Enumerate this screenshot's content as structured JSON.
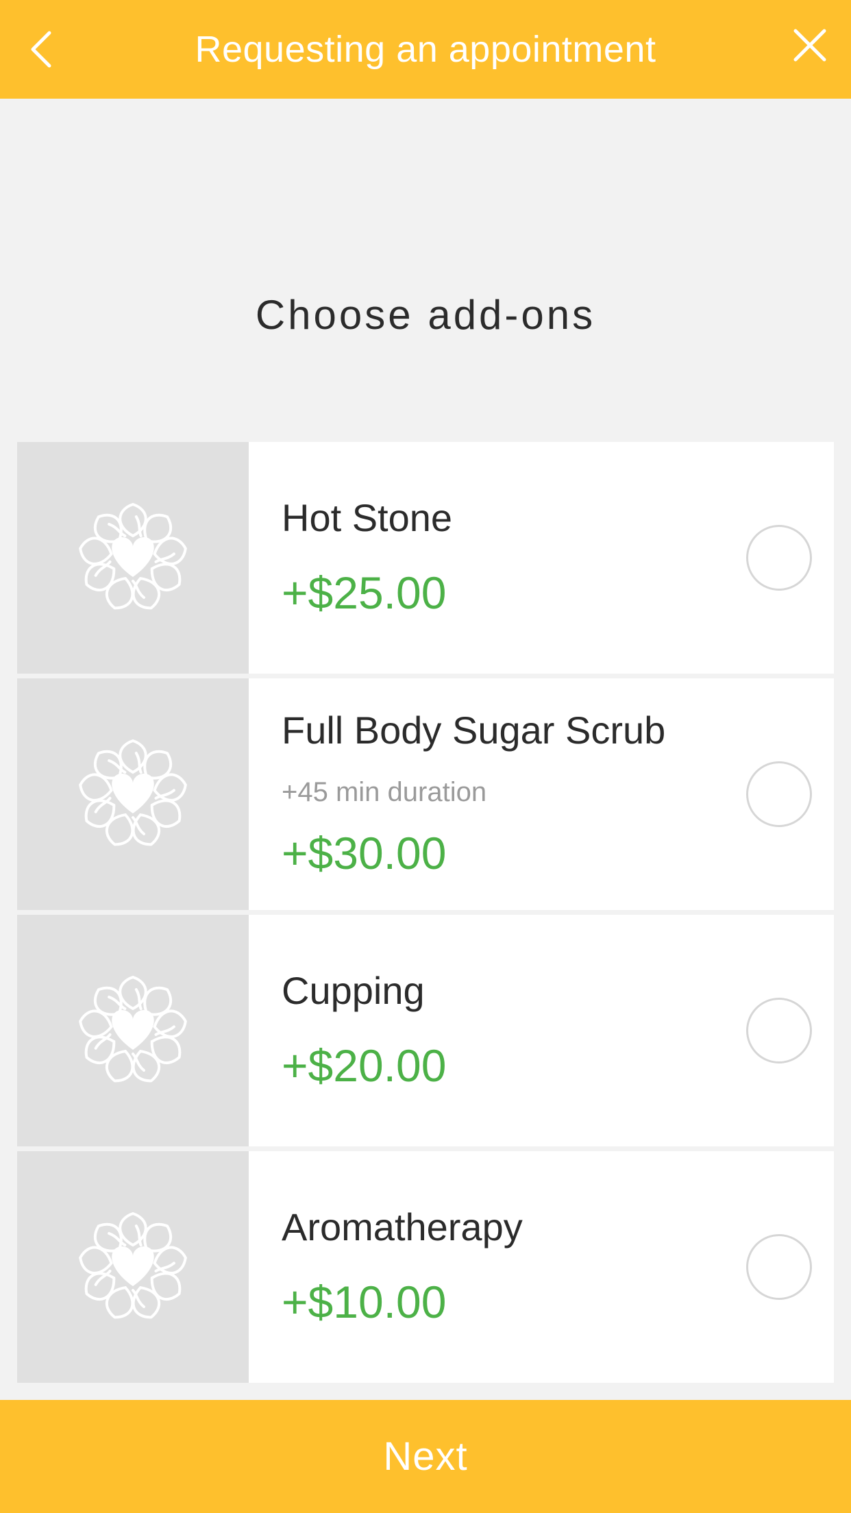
{
  "header": {
    "title": "Requesting an appointment",
    "back_icon": "chevron-left-icon",
    "close_icon": "close-icon"
  },
  "section_title": "Choose add-ons",
  "addons": [
    {
      "name": "Hot Stone",
      "duration": "",
      "price": "+$25.00",
      "icon": "lotus-heart-icon"
    },
    {
      "name": "Full Body Sugar Scrub",
      "duration": "+45 min duration",
      "price": "+$30.00",
      "icon": "lotus-heart-icon"
    },
    {
      "name": "Cupping",
      "duration": "",
      "price": "+$20.00",
      "icon": "lotus-heart-icon"
    },
    {
      "name": "Aromatherapy",
      "duration": "",
      "price": "+$10.00",
      "icon": "lotus-heart-icon"
    }
  ],
  "footer": {
    "next_label": "Next"
  },
  "colors": {
    "accent": "#fec02d",
    "price": "#4cb147",
    "background": "#f2f2f2"
  }
}
